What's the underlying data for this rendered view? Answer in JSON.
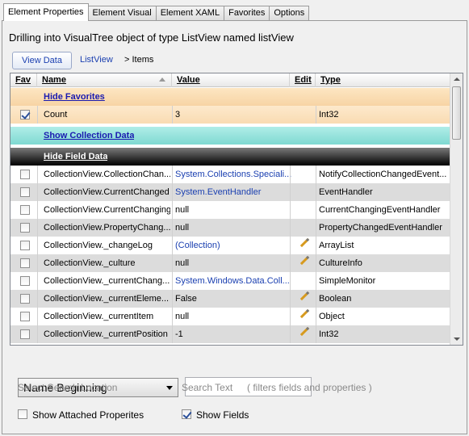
{
  "tabs": [
    "Element Properties",
    "Element Visual",
    "Element XAML",
    "Favorites",
    "Options"
  ],
  "heading": "Drilling into VisualTree object of type ListView named listView",
  "breadcrumb": {
    "button": "View Data",
    "link": "ListView",
    "current": "> Items"
  },
  "grid": {
    "headers": {
      "fav": "Fav",
      "name": "Name",
      "value": "Value",
      "edit": "Edit",
      "type": "Type"
    },
    "sections": {
      "favorites": "Hide Favorites",
      "collection": "Show Collection Data",
      "fields": "Hide Field Data"
    },
    "favorite_rows": [
      {
        "name": "Count",
        "value": "3",
        "type": "Int32",
        "checked": true
      }
    ],
    "field_rows": [
      {
        "name": "CollectionView.CollectionChan...",
        "value": "System.Collections.Speciali...",
        "type": "NotifyCollectionChangedEvent...",
        "value_link": true,
        "editable": false
      },
      {
        "name": "CollectionView.CurrentChanged",
        "value": "System.EventHandler",
        "type": "EventHandler",
        "value_link": true,
        "editable": false
      },
      {
        "name": "CollectionView.CurrentChanging",
        "value": "null",
        "type": "CurrentChangingEventHandler",
        "value_link": false,
        "editable": false
      },
      {
        "name": "CollectionView.PropertyChang...",
        "value": "null",
        "type": "PropertyChangedEventHandler",
        "value_link": false,
        "editable": false
      },
      {
        "name": "CollectionView._changeLog",
        "value": "(Collection)",
        "type": "ArrayList",
        "value_link": true,
        "editable": true
      },
      {
        "name": "CollectionView._culture",
        "value": "null",
        "type": "CultureInfo",
        "value_link": false,
        "editable": true
      },
      {
        "name": "CollectionView._currentChang...",
        "value": "System.Windows.Data.Coll...",
        "type": "SimpleMonitor",
        "value_link": true,
        "editable": false
      },
      {
        "name": "CollectionView._currentEleme...",
        "value": "False",
        "type": "Boolean",
        "value_link": false,
        "editable": true
      },
      {
        "name": "CollectionView._currentItem",
        "value": "null",
        "type": "Object",
        "value_link": false,
        "editable": true
      },
      {
        "name": "CollectionView._currentPosition",
        "value": "-1",
        "type": "Int32",
        "value_link": false,
        "editable": true
      }
    ]
  },
  "search": {
    "location_selected": "Name Beginning",
    "location_label": "Select Search Location",
    "text_value": "",
    "text_label": "Search Text",
    "text_hint": "( filters fields and properties )"
  },
  "options": {
    "attached_label": "Show Attached Properites",
    "attached_checked": false,
    "fields_label": "Show Fields",
    "fields_checked": true
  },
  "colors": {
    "favorites_band": "#f7d4a4",
    "collection_band": "#7fd9d2",
    "fields_band": "#000000",
    "link": "#1a3fb0"
  }
}
